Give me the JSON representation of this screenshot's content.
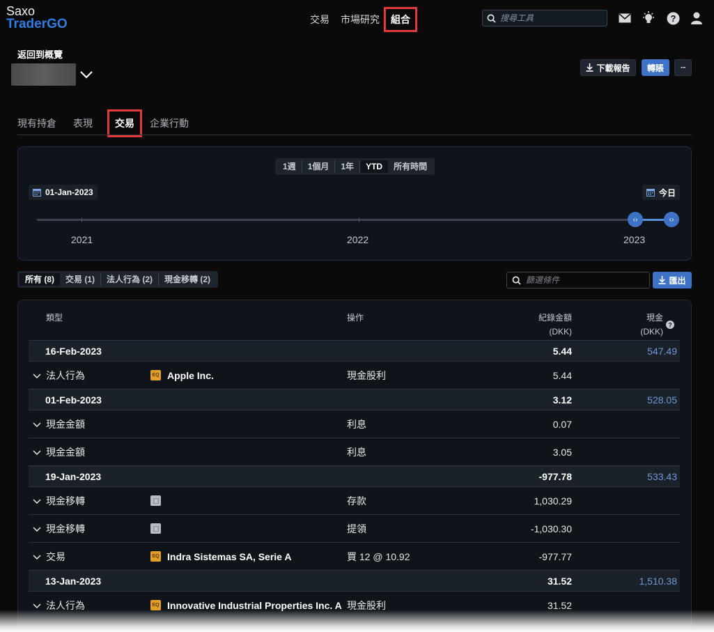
{
  "brand": {
    "line1": "Saxo",
    "line2": "TraderGO"
  },
  "nav": {
    "items": [
      "交易",
      "市場研究",
      "組合"
    ],
    "active": "組合"
  },
  "search": {
    "placeholder": "搜尋工具"
  },
  "header": {
    "back_label": "返回到概覽",
    "download_label": "下載報告",
    "transfer_label": "轉賬",
    "more_label": "···"
  },
  "tabs": {
    "items": [
      "現有持倉",
      "表現",
      "交易",
      "企業行動"
    ],
    "active": "交易"
  },
  "timeline": {
    "periods": [
      "1週",
      "1個月",
      "1年",
      "YTD",
      "所有時間"
    ],
    "active_period": "YTD",
    "start_date": "01-Jan-2023",
    "end_date": "今日",
    "years": [
      "2021",
      "2022",
      "2023"
    ]
  },
  "filters": {
    "items": [
      "所有 (8)",
      "交易 (1)",
      "法人行為 (2)",
      "現金移轉 (2)"
    ],
    "active": "所有 (8)",
    "search_placeholder": "篩選條件",
    "export_label": "匯出"
  },
  "table": {
    "columns": {
      "type": "類型",
      "action": "操作",
      "booked_amount": "紀錄金額",
      "booked_unit": "(DKK)",
      "cash": "現金",
      "cash_unit": "(DKK)"
    },
    "groups": [
      {
        "date": "16-Feb-2023",
        "amount": "5.44",
        "cash": "547.49",
        "rows": [
          {
            "type": "法人行為",
            "badge": "eq",
            "instrument": "Apple Inc.",
            "action": "現金股利",
            "amount": "5.44"
          }
        ]
      },
      {
        "date": "01-Feb-2023",
        "amount": "3.12",
        "cash": "528.05",
        "rows": [
          {
            "type": "現金金額",
            "badge": "",
            "instrument": "",
            "action": "利息",
            "amount": "0.07"
          },
          {
            "type": "現金金額",
            "badge": "",
            "instrument": "",
            "action": "利息",
            "amount": "3.05"
          }
        ]
      },
      {
        "date": "19-Jan-2023",
        "amount": "-977.78",
        "cash": "533.43",
        "rows": [
          {
            "type": "現金移轉",
            "badge": "doc",
            "instrument": "",
            "action": "存款",
            "amount": "1,030.29"
          },
          {
            "type": "現金移轉",
            "badge": "doc",
            "instrument": "",
            "action": "提領",
            "amount": "-1,030.30"
          },
          {
            "type": "交易",
            "badge": "eq",
            "instrument": "Indra Sistemas SA, Serie A",
            "action": "買 12 @ 10.92",
            "amount": "-977.77"
          }
        ]
      },
      {
        "date": "13-Jan-2023",
        "amount": "31.52",
        "cash": "1,510.38",
        "rows": [
          {
            "type": "法人行為",
            "badge": "eq",
            "instrument": "Innovative Industrial Properties Inc. A",
            "action": "現金股利",
            "amount": "31.52"
          }
        ]
      }
    ],
    "eq_badge_label": "EQ"
  },
  "colors": {
    "accent": "#3e72c7",
    "cash": "#6e98d8",
    "highlight": "#e23a3a"
  }
}
